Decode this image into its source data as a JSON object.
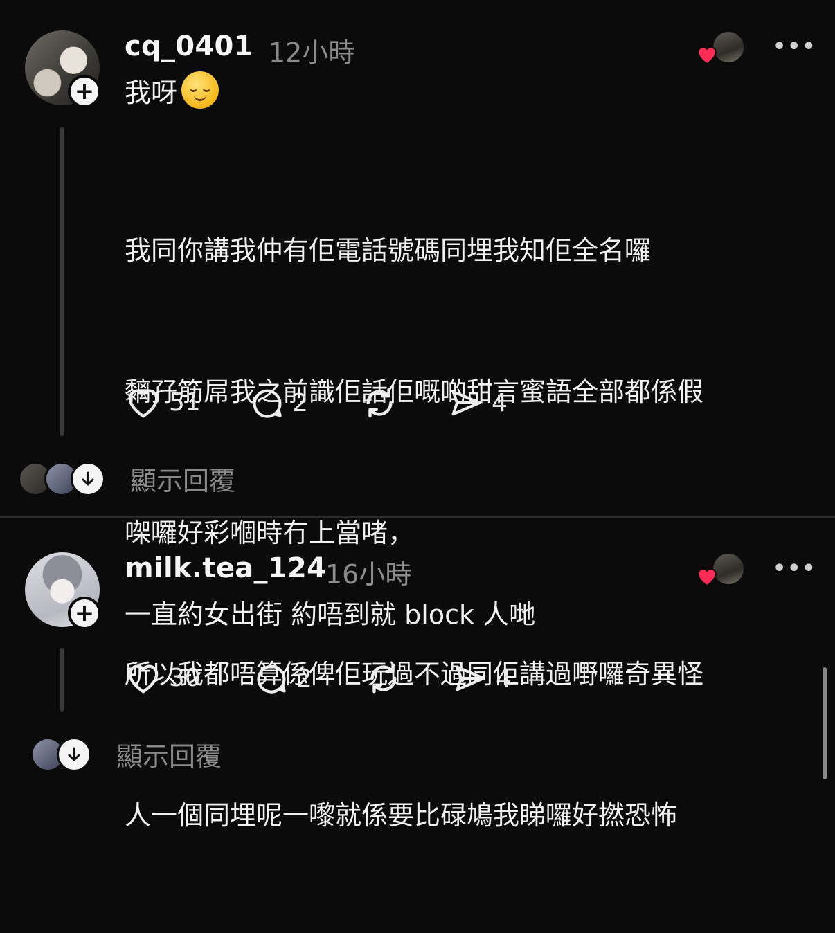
{
  "posts": [
    {
      "username": "cq_0401",
      "time": "12小時",
      "first_line": "我呀",
      "emoji": "relieved-face-emoji",
      "paragraph": [
        "我同你講我仲有佢電話號碼同埋我知佢全名囉",
        "黐孖筋屌我之前識佢話佢嘅啲甜言蜜語全部都係假",
        "㗎囉好彩嗰時冇上當啫，",
        "所以我都唔算係俾佢玩過不過同佢講過嘢囉奇異怪",
        "人一個同埋呢一嚟就係要比碌鳩我睇囉好撚恐怖"
      ],
      "likes": "51",
      "comments": "2",
      "shares": "4",
      "show_replies": "顯示回覆",
      "avatar": "cat-photo-avatar"
    },
    {
      "username": "milk.tea_124",
      "time": "16小時",
      "text": "一直約女出街 約唔到就 block 人哋",
      "likes": "30",
      "comments": "2",
      "shares": "4",
      "show_replies": "顯示回覆",
      "avatar": "anime-girl-avatar"
    }
  ],
  "colors": {
    "background": "#0b0b0b",
    "text": "#f3f3f3",
    "muted": "#8c8c8c",
    "heart": "#ff2d55"
  }
}
